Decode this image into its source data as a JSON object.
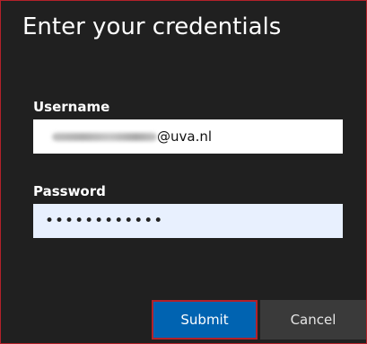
{
  "dialog": {
    "title": "Enter your credentials",
    "username": {
      "label": "Username",
      "value_suffix": "@uva.nl"
    },
    "password": {
      "label": "Password",
      "masked_value": "••••••••••••"
    },
    "buttons": {
      "submit_label": "Submit",
      "cancel_label": "Cancel"
    }
  },
  "colors": {
    "background": "#202020",
    "border_accent": "#b3212a",
    "submit_blue": "#0063b1",
    "cancel_gray": "#3a3a3a",
    "password_field_bg": "#e8f0fe"
  }
}
